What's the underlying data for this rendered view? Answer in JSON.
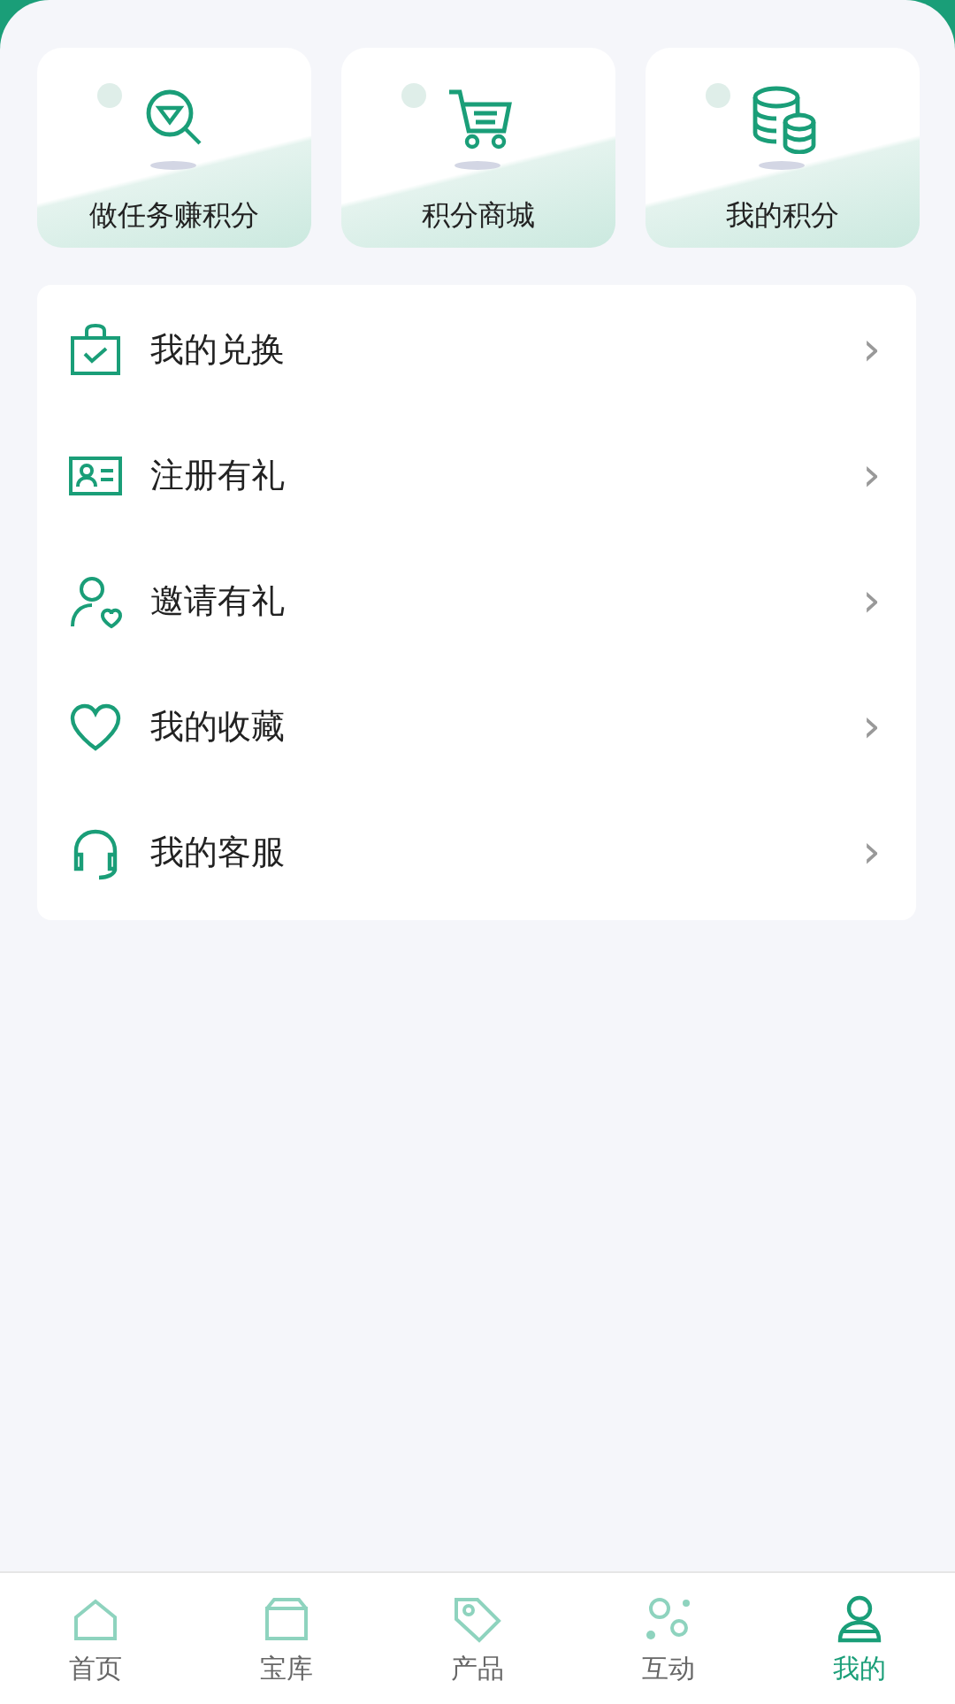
{
  "shortcuts": [
    {
      "label": "做任务赚积分"
    },
    {
      "label": "积分商城"
    },
    {
      "label": "我的积分"
    }
  ],
  "menu": [
    {
      "label": "我的兑换",
      "arrow": "›"
    },
    {
      "label": "注册有礼",
      "arrow": "›"
    },
    {
      "label": "邀请有礼",
      "arrow": "›"
    },
    {
      "label": "我的收藏",
      "arrow": "›"
    },
    {
      "label": "我的客服",
      "arrow": "›"
    }
  ],
  "tab_bar": [
    {
      "label": "首页",
      "selected": false
    },
    {
      "label": "宝库",
      "selected": false
    },
    {
      "label": "产品",
      "selected": false
    },
    {
      "label": "互动",
      "selected": false
    },
    {
      "label": "我的",
      "selected": true
    }
  ]
}
